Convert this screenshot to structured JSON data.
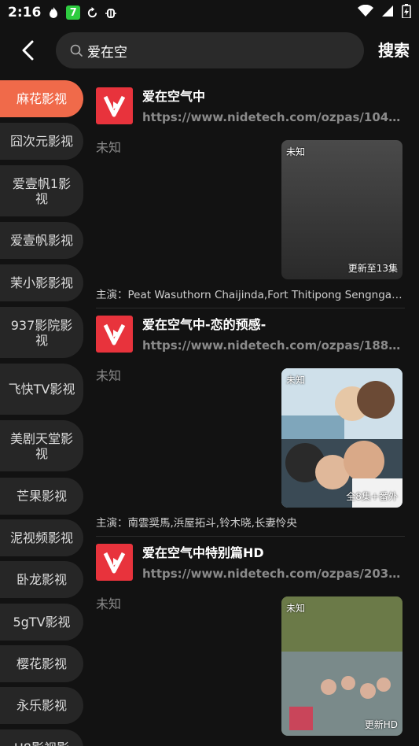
{
  "status_bar": {
    "time": "2:16",
    "icons": [
      "flame-icon",
      "badge-7-icon",
      "sync-icon",
      "bug-icon"
    ],
    "badge_text": "7",
    "wifi": "wifi-icon",
    "signal": "signal-icon",
    "battery": "battery-icon"
  },
  "search": {
    "query": "爱在空",
    "button_label": "搜索"
  },
  "sidebar": {
    "items": [
      {
        "label": "麻花影视",
        "active": true
      },
      {
        "label": "囧次元影视"
      },
      {
        "label": "爱壹帆1影视"
      },
      {
        "label": "爱壹帆影视"
      },
      {
        "label": "茉小影影视"
      },
      {
        "label": "937影院影视"
      },
      {
        "label": "飞快TV影视"
      },
      {
        "label": "美剧天堂影视"
      },
      {
        "label": "芒果影视"
      },
      {
        "label": "泥视频影视"
      },
      {
        "label": "卧龙影视"
      },
      {
        "label": "5gTV影视"
      },
      {
        "label": "樱花影视"
      },
      {
        "label": "永乐影视"
      },
      {
        "label": "U8影视影"
      }
    ]
  },
  "results": [
    {
      "title": "爱在空气中",
      "url": "https://www.nidetech.com/ozpas/104130.html",
      "status": "未知",
      "poster_tag": "未知",
      "poster_episode": "更新至13集",
      "cast_label": "主演：",
      "cast": "Peat Wasuthorn Chaijinda,Fort Thitipong Sengngai,Bo..."
    },
    {
      "title": "爱在空气中-恋的预感-",
      "url": "https://www.nidetech.com/ozpas/188310.html",
      "status": "未知",
      "poster_tag": "未知",
      "poster_episode": "全8集+番外",
      "cast_label": "主演：",
      "cast": "南雲奨馬,浜屋拓斗,铃木晓,长妻怜央"
    },
    {
      "title": "爱在空气中特别篇HD",
      "url": "https://www.nidetech.com/ozpas/203549.html",
      "status": "未知",
      "poster_tag": "未知",
      "poster_episode": "更新HD",
      "cast_label": "主演：",
      "cast": ""
    }
  ],
  "colors": {
    "accent": "#f06a4a",
    "logo_red": "#e8333c",
    "background": "#121212"
  }
}
